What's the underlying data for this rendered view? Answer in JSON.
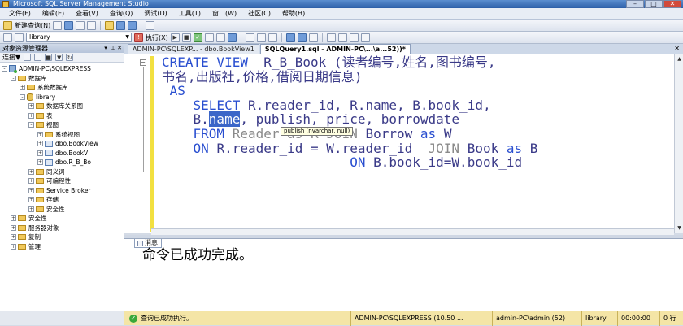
{
  "window": {
    "title": "Microsoft SQL Server Management Studio"
  },
  "menu": [
    "文件(F)",
    "编辑(E)",
    "查看(V)",
    "查询(Q)",
    "调试(D)",
    "工具(T)",
    "窗口(W)",
    "社区(C)",
    "帮助(H)"
  ],
  "toolbar1": {
    "new_query_label": "新建查询(N)"
  },
  "toolbar2": {
    "database": "library",
    "execute_label": "执行(X)"
  },
  "object_explorer": {
    "title": "对象资源管理器",
    "connect_label": "连接▼",
    "tree": [
      {
        "label": "ADMIN-PC\\SQLEXPRESS",
        "icon": "server",
        "depth": 0,
        "exp": "-"
      },
      {
        "label": "数据库",
        "icon": "folder",
        "depth": 1,
        "exp": "-"
      },
      {
        "label": "系统数据库",
        "icon": "folder",
        "depth": 2,
        "exp": "+"
      },
      {
        "label": "library",
        "icon": "db",
        "depth": 2,
        "exp": "-"
      },
      {
        "label": "数据库关系图",
        "icon": "folder",
        "depth": 3,
        "exp": "+"
      },
      {
        "label": "表",
        "icon": "folder",
        "depth": 3,
        "exp": "+"
      },
      {
        "label": "视图",
        "icon": "folder",
        "depth": 3,
        "exp": "-"
      },
      {
        "label": "系统视图",
        "icon": "folder",
        "depth": 4,
        "exp": "+"
      },
      {
        "label": "dbo.BookView",
        "icon": "view",
        "depth": 4,
        "exp": "+"
      },
      {
        "label": "dbo.BookV",
        "icon": "view",
        "depth": 4,
        "exp": "+"
      },
      {
        "label": "dbo.R_B_Bo",
        "icon": "view",
        "depth": 4,
        "exp": "+"
      },
      {
        "label": "同义词",
        "icon": "folder",
        "depth": 3,
        "exp": "+"
      },
      {
        "label": "可编程性",
        "icon": "folder",
        "depth": 3,
        "exp": "+"
      },
      {
        "label": "Service Broker",
        "icon": "folder",
        "depth": 3,
        "exp": "+"
      },
      {
        "label": "存储",
        "icon": "folder",
        "depth": 3,
        "exp": "+"
      },
      {
        "label": "安全性",
        "icon": "folder",
        "depth": 3,
        "exp": "+"
      },
      {
        "label": "安全性",
        "icon": "folder",
        "depth": 1,
        "exp": "+"
      },
      {
        "label": "服务器对象",
        "icon": "folder",
        "depth": 1,
        "exp": "+"
      },
      {
        "label": "复制",
        "icon": "folder",
        "depth": 1,
        "exp": "+"
      },
      {
        "label": "管理",
        "icon": "folder",
        "depth": 1,
        "exp": "+"
      }
    ]
  },
  "tabs": [
    {
      "label": "ADMIN-PC\\SQLEXP... - dbo.BookView1",
      "active": false
    },
    {
      "label": "SQLQuery1.sql - ADMIN-PC\\...\\a...52))*",
      "active": true
    }
  ],
  "editor": {
    "lines": [
      [
        {
          "t": "CREATE VIEW  ",
          "c": "kw"
        },
        {
          "t": "R_B_Book (读者编号,姓名,图书编号,",
          "c": "cn"
        }
      ],
      [
        {
          "t": "书名,出版社,价格,借阅日期信息)",
          "c": "cn"
        }
      ],
      [
        {
          "t": " AS",
          "c": "kw"
        }
      ],
      [
        {
          "t": "    SELECT ",
          "c": "kw"
        },
        {
          "t": "R.reader_id, R.name, B.book_id,",
          "c": "cn"
        }
      ],
      [
        {
          "t": "    B.",
          "c": "cn"
        },
        {
          "t": "name",
          "c": "hl"
        },
        {
          "t": ", publish, price, borrowdate",
          "c": "cn"
        }
      ],
      [
        {
          "t": "    FROM ",
          "c": "kw"
        },
        {
          "t": "Reader as R ",
          "c": "grey"
        },
        {
          "t": "JOIN ",
          "c": "grey"
        },
        {
          "t": "Borrow ",
          "c": "cn"
        },
        {
          "t": "as ",
          "c": "kw"
        },
        {
          "t": "W",
          "c": "cn"
        }
      ],
      [
        {
          "t": "    ON ",
          "c": "kw"
        },
        {
          "t": "R.reader_id = W.reader_id  ",
          "c": "cn"
        },
        {
          "t": "JOIN ",
          "c": "grey"
        },
        {
          "t": "Book ",
          "c": "cn"
        },
        {
          "t": "as ",
          "c": "kw"
        },
        {
          "t": "B",
          "c": "cn"
        }
      ],
      [
        {
          "t": "                        ON ",
          "c": "kw"
        },
        {
          "t": "B.book_id=W.book_id",
          "c": "cn"
        }
      ]
    ],
    "tooltip": "publish (nvarchar, null)"
  },
  "messages": {
    "tab_label": "消息",
    "text": "命令已成功完成。"
  },
  "status": {
    "message": "查询已成功执行。",
    "server": "ADMIN-PC\\SQLEXPRESS (10.50 ...",
    "user": "admin-PC\\admin (52)",
    "database": "library",
    "time": "00:00:00",
    "rows": "0 行"
  },
  "colors": {
    "keyword": "#2a4fd0",
    "identifier": "#3a3a88",
    "comment_grey": "#8a8a8a",
    "selection": "#3b66c8",
    "status_bg": "#f4e5a6"
  }
}
